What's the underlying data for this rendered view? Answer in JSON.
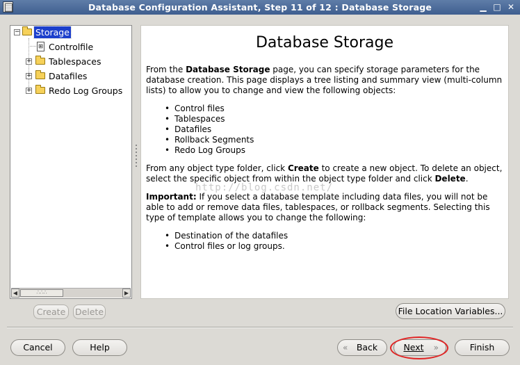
{
  "window": {
    "title": "Database Configuration Assistant, Step 11 of 12 : Database Storage",
    "controls": {
      "minimize": "▁",
      "maximize": "□",
      "close": "✕"
    }
  },
  "tree": {
    "root": "Storage",
    "items": [
      {
        "label": "Controlfile",
        "icon": "document-icon"
      },
      {
        "label": "Tablespaces",
        "icon": "folder-icon"
      },
      {
        "label": "Datafiles",
        "icon": "folder-icon"
      },
      {
        "label": "Redo Log Groups",
        "icon": "folder-icon"
      }
    ]
  },
  "content": {
    "heading": "Database Storage",
    "intro_1": "From the ",
    "intro_bold": "Database Storage",
    "intro_2": " page, you can specify storage parameters for the database creation. This page displays a tree listing and summary view (multi-column lists) to allow you to change and view the following objects:",
    "objects": [
      "Control files",
      "Tablespaces",
      "Datafiles",
      "Rollback Segments",
      "Redo Log Groups"
    ],
    "create_1": "From any object type folder, click ",
    "create_bold": "Create",
    "create_2": " to create a new object. To delete an object, select the specific object from within the object type folder and click ",
    "delete_bold": "Delete",
    "create_3": ".",
    "important_bold": "Important:",
    "important_text": " If you select a database template including data files, you will not be able to add or remove data files, tablespaces, or rollback segments. Selecting this type of template allows you to change the following:",
    "changeable": [
      "Destination of the datafiles",
      "Control files or log groups."
    ],
    "watermark": "http://blog.csdn.net/"
  },
  "buttons": {
    "create": "Create",
    "delete": "Delete",
    "file_location": "File Location Variables...",
    "cancel": "Cancel",
    "help": "Help",
    "back": "Back",
    "next": "Next",
    "finish": "Finish"
  },
  "colors": {
    "titlebar": "#4a6a9c",
    "selection": "#1c3fcc",
    "highlight_ring": "#e02424"
  }
}
